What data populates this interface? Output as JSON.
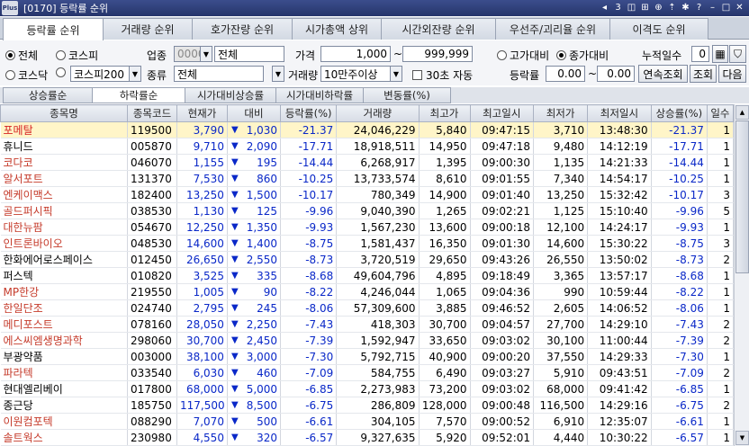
{
  "window": {
    "logo": "Plus",
    "title": "[0170] 등락률 순위",
    "tools": [
      "◂",
      "3",
      "◫",
      "⊞",
      "⊕",
      "⇡",
      "✱",
      "?",
      "–",
      "□",
      "✕"
    ]
  },
  "main_tabs": [
    {
      "label": "등락률 순위",
      "active": true
    },
    {
      "label": "거래량 순위",
      "active": false
    },
    {
      "label": "호가잔량 순위",
      "active": false
    },
    {
      "label": "시가총액 상위",
      "active": false
    },
    {
      "label": "시간외잔량 순위",
      "active": false
    },
    {
      "label": "우선주/괴리율 순위",
      "active": false
    },
    {
      "label": "이격도 순위",
      "active": false
    }
  ],
  "filters": {
    "market_all": "전체",
    "market_kospi": "코스피",
    "market_kosdaq": "코스닥",
    "index_select": "코스피200",
    "sector_label": "업종",
    "sector_code": "0000",
    "sector_name": "전체",
    "kind_label": "종류",
    "kind_value": "전체",
    "price_label": "가격",
    "price_from": "1,000",
    "price_tilde": "~",
    "price_to": "999,999",
    "volume_label": "거래량",
    "volume_value": "10만주이상",
    "auto_label": "30초 자동",
    "vs_high": "고가대비",
    "vs_close": "종가대비",
    "cum_days_label": "누적일수",
    "cum_days": "0",
    "rate_label": "등락률",
    "rate_from": "0.00",
    "rate_tilde": "~",
    "rate_to": "0.00",
    "btn_continuous": "연속조회",
    "btn_query": "조회",
    "btn_next": "다음"
  },
  "sub_tabs": [
    {
      "label": "상승률순",
      "active": false
    },
    {
      "label": "하락률순",
      "active": true
    },
    {
      "label": "시가대비상승률",
      "active": false
    },
    {
      "label": "시가대비하락률",
      "active": false
    },
    {
      "label": "변동률(%)",
      "active": false
    }
  ],
  "columns": [
    "종목명",
    "종목코드",
    "현재가",
    "대비",
    "등락률(%)",
    "거래량",
    "최고가",
    "최고일시",
    "최저가",
    "최저일시",
    "상승률(%)",
    "일수"
  ],
  "rows": [
    {
      "name": "포메탈",
      "code": "119500",
      "price": "3,790",
      "arrow": "▼",
      "diff": "1,030",
      "rate": "-21.37",
      "volume": "24,046,229",
      "high": "5,840",
      "high_t": "09:47:15",
      "low": "3,710",
      "low_t": "13:48:30",
      "up_rate": "-21.37",
      "days": "1",
      "color": "red"
    },
    {
      "name": "휴니드",
      "code": "005870",
      "price": "9,710",
      "arrow": "▼",
      "diff": "2,090",
      "rate": "-17.71",
      "volume": "18,918,511",
      "high": "14,950",
      "high_t": "09:47:18",
      "low": "9,480",
      "low_t": "14:12:19",
      "up_rate": "-17.71",
      "days": "1",
      "color": "black"
    },
    {
      "name": "코다코",
      "code": "046070",
      "price": "1,155",
      "arrow": "▼",
      "diff": "195",
      "rate": "-14.44",
      "volume": "6,268,917",
      "high": "1,395",
      "high_t": "09:00:30",
      "low": "1,135",
      "low_t": "14:21:33",
      "up_rate": "-14.44",
      "days": "1",
      "color": "red"
    },
    {
      "name": "알서포트",
      "code": "131370",
      "price": "7,530",
      "arrow": "▼",
      "diff": "860",
      "rate": "-10.25",
      "volume": "13,733,574",
      "high": "8,610",
      "high_t": "09:01:55",
      "low": "7,340",
      "low_t": "14:54:17",
      "up_rate": "-10.25",
      "days": "1",
      "color": "red"
    },
    {
      "name": "엔케이맥스",
      "code": "182400",
      "price": "13,250",
      "arrow": "▼",
      "diff": "1,500",
      "rate": "-10.17",
      "volume": "780,349",
      "high": "14,900",
      "high_t": "09:01:40",
      "low": "13,250",
      "low_t": "15:32:42",
      "up_rate": "-10.17",
      "days": "3",
      "color": "red"
    },
    {
      "name": "골드퍼시픽",
      "code": "038530",
      "price": "1,130",
      "arrow": "▼",
      "diff": "125",
      "rate": "-9.96",
      "volume": "9,040,390",
      "high": "1,265",
      "high_t": "09:02:21",
      "low": "1,125",
      "low_t": "15:10:40",
      "up_rate": "-9.96",
      "days": "5",
      "color": "red"
    },
    {
      "name": "대한뉴팜",
      "code": "054670",
      "price": "12,250",
      "arrow": "▼",
      "diff": "1,350",
      "rate": "-9.93",
      "volume": "1,567,230",
      "high": "13,600",
      "high_t": "09:00:18",
      "low": "12,100",
      "low_t": "14:24:17",
      "up_rate": "-9.93",
      "days": "1",
      "color": "red"
    },
    {
      "name": "인트론바이오",
      "code": "048530",
      "price": "14,600",
      "arrow": "▼",
      "diff": "1,400",
      "rate": "-8.75",
      "volume": "1,581,437",
      "high": "16,350",
      "high_t": "09:01:30",
      "low": "14,600",
      "low_t": "15:30:22",
      "up_rate": "-8.75",
      "days": "3",
      "color": "red"
    },
    {
      "name": "한화에어로스페이스",
      "code": "012450",
      "price": "26,650",
      "arrow": "▼",
      "diff": "2,550",
      "rate": "-8.73",
      "volume": "3,720,519",
      "high": "29,650",
      "high_t": "09:43:26",
      "low": "26,550",
      "low_t": "13:50:02",
      "up_rate": "-8.73",
      "days": "2",
      "color": "black"
    },
    {
      "name": "퍼스텍",
      "code": "010820",
      "price": "3,525",
      "arrow": "▼",
      "diff": "335",
      "rate": "-8.68",
      "volume": "49,604,796",
      "high": "4,895",
      "high_t": "09:18:49",
      "low": "3,365",
      "low_t": "13:57:17",
      "up_rate": "-8.68",
      "days": "1",
      "color": "black"
    },
    {
      "name": "MP한강",
      "code": "219550",
      "price": "1,005",
      "arrow": "▼",
      "diff": "90",
      "rate": "-8.22",
      "volume": "4,246,044",
      "high": "1,065",
      "high_t": "09:04:36",
      "low": "990",
      "low_t": "10:59:44",
      "up_rate": "-8.22",
      "days": "1",
      "color": "red"
    },
    {
      "name": "한일단조",
      "code": "024740",
      "price": "2,795",
      "arrow": "▼",
      "diff": "245",
      "rate": "-8.06",
      "volume": "57,309,600",
      "high": "3,885",
      "high_t": "09:46:52",
      "low": "2,605",
      "low_t": "14:06:52",
      "up_rate": "-8.06",
      "days": "1",
      "color": "red"
    },
    {
      "name": "메디포스트",
      "code": "078160",
      "price": "28,050",
      "arrow": "▼",
      "diff": "2,250",
      "rate": "-7.43",
      "volume": "418,303",
      "high": "30,700",
      "high_t": "09:04:57",
      "low": "27,700",
      "low_t": "14:29:10",
      "up_rate": "-7.43",
      "days": "2",
      "color": "red"
    },
    {
      "name": "에스씨엠생명과학",
      "code": "298060",
      "price": "30,700",
      "arrow": "▼",
      "diff": "2,450",
      "rate": "-7.39",
      "volume": "1,592,947",
      "high": "33,650",
      "high_t": "09:03:02",
      "low": "30,100",
      "low_t": "11:00:44",
      "up_rate": "-7.39",
      "days": "2",
      "color": "red"
    },
    {
      "name": "부광약품",
      "code": "003000",
      "price": "38,100",
      "arrow": "▼",
      "diff": "3,000",
      "rate": "-7.30",
      "volume": "5,792,715",
      "high": "40,900",
      "high_t": "09:00:20",
      "low": "37,550",
      "low_t": "14:29:33",
      "up_rate": "-7.30",
      "days": "1",
      "color": "black"
    },
    {
      "name": "파라텍",
      "code": "033540",
      "price": "6,030",
      "arrow": "▼",
      "diff": "460",
      "rate": "-7.09",
      "volume": "584,755",
      "high": "6,490",
      "high_t": "09:03:27",
      "low": "5,910",
      "low_t": "09:43:51",
      "up_rate": "-7.09",
      "days": "2",
      "color": "red"
    },
    {
      "name": "현대엘리베이",
      "code": "017800",
      "price": "68,000",
      "arrow": "▼",
      "diff": "5,000",
      "rate": "-6.85",
      "volume": "2,273,983",
      "high": "73,200",
      "high_t": "09:03:02",
      "low": "68,000",
      "low_t": "09:41:42",
      "up_rate": "-6.85",
      "days": "1",
      "color": "black"
    },
    {
      "name": "종근당",
      "code": "185750",
      "price": "117,500",
      "arrow": "▼",
      "diff": "8,500",
      "rate": "-6.75",
      "volume": "286,809",
      "high": "128,000",
      "high_t": "09:00:48",
      "low": "116,500",
      "low_t": "14:29:16",
      "up_rate": "-6.75",
      "days": "2",
      "color": "black"
    },
    {
      "name": "이원컴포텍",
      "code": "088290",
      "price": "7,070",
      "arrow": "▼",
      "diff": "500",
      "rate": "-6.61",
      "volume": "304,105",
      "high": "7,570",
      "high_t": "09:00:52",
      "low": "6,910",
      "low_t": "12:35:07",
      "up_rate": "-6.61",
      "days": "1",
      "color": "red"
    },
    {
      "name": "솔트웍스",
      "code": "230980",
      "price": "4,550",
      "arrow": "▼",
      "diff": "320",
      "rate": "-6.57",
      "volume": "9,327,635",
      "high": "5,920",
      "high_t": "09:52:01",
      "low": "4,440",
      "low_t": "10:30:22",
      "up_rate": "-6.57",
      "days": "1",
      "color": "red"
    }
  ]
}
